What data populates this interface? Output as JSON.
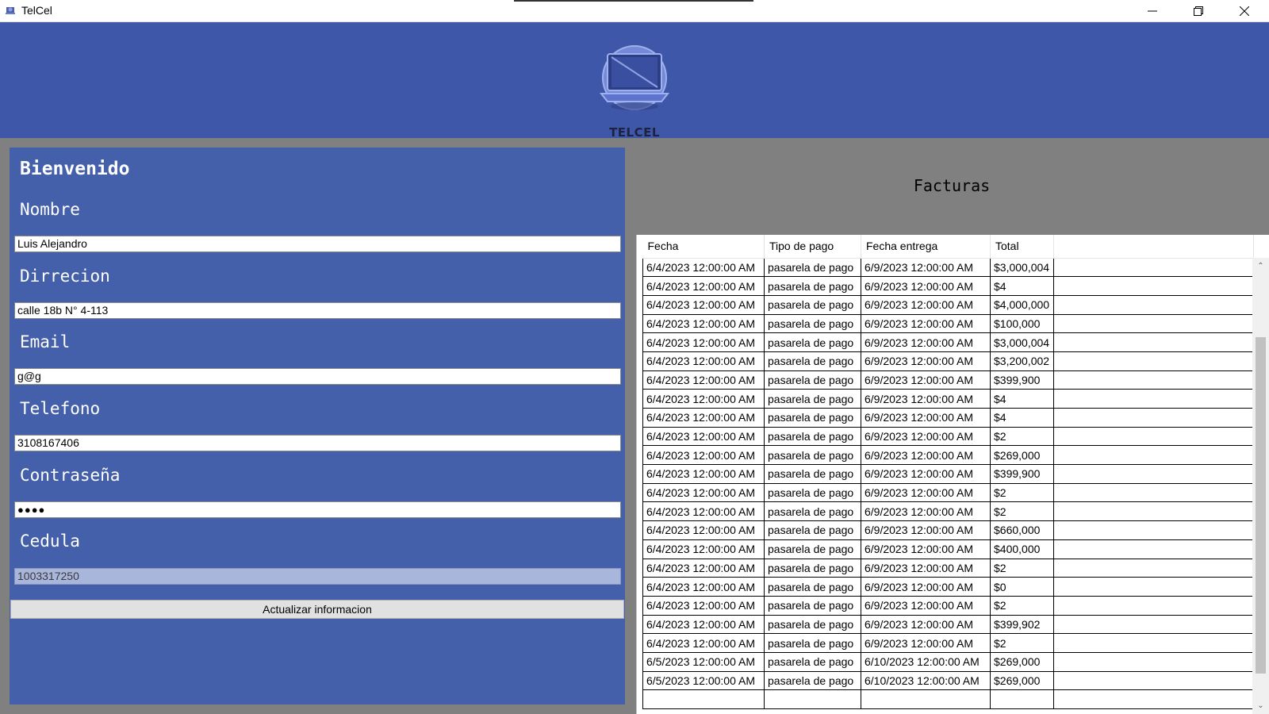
{
  "window": {
    "title": "TelCel",
    "icons": {
      "app": "app-icon",
      "minimize": "minimize-icon",
      "maximize": "restore-icon",
      "close": "close-icon"
    }
  },
  "header": {
    "logo_text": "TELCEL",
    "logo_icon": "laptop-globe-logo"
  },
  "profile": {
    "welcome": "Bienvenido",
    "fields": [
      {
        "label": "Nombre",
        "value": "Luis Alejandro"
      },
      {
        "label": "Dirrecion",
        "value": "calle 18b N° 4-113"
      },
      {
        "label": "Email",
        "value": "g@g"
      },
      {
        "label": "Telefono",
        "value": "3108167406"
      },
      {
        "label": "Contraseña",
        "value": "●●●●"
      },
      {
        "label": "Cedula",
        "value": "1003317250"
      }
    ],
    "update_button": "Actualizar informacion"
  },
  "invoices": {
    "title": "Facturas",
    "columns": [
      "Fecha",
      "Tipo de pago",
      "Fecha entrega",
      "Total"
    ],
    "rows": [
      [
        "6/4/2023 12:00:00 AM",
        "pasarela de pago",
        "6/9/2023 12:00:00 AM",
        "$3,000,004"
      ],
      [
        "6/4/2023 12:00:00 AM",
        "pasarela de pago",
        "6/9/2023 12:00:00 AM",
        "$4"
      ],
      [
        "6/4/2023 12:00:00 AM",
        "pasarela de pago",
        "6/9/2023 12:00:00 AM",
        "$4,000,000"
      ],
      [
        "6/4/2023 12:00:00 AM",
        "pasarela de pago",
        "6/9/2023 12:00:00 AM",
        "$100,000"
      ],
      [
        "6/4/2023 12:00:00 AM",
        "pasarela de pago",
        "6/9/2023 12:00:00 AM",
        "$3,000,004"
      ],
      [
        "6/4/2023 12:00:00 AM",
        "pasarela de pago",
        "6/9/2023 12:00:00 AM",
        "$3,200,002"
      ],
      [
        "6/4/2023 12:00:00 AM",
        "pasarela de pago",
        "6/9/2023 12:00:00 AM",
        "$399,900"
      ],
      [
        "6/4/2023 12:00:00 AM",
        "pasarela de pago",
        "6/9/2023 12:00:00 AM",
        "$4"
      ],
      [
        "6/4/2023 12:00:00 AM",
        "pasarela de pago",
        "6/9/2023 12:00:00 AM",
        "$4"
      ],
      [
        "6/4/2023 12:00:00 AM",
        "pasarela de pago",
        "6/9/2023 12:00:00 AM",
        "$2"
      ],
      [
        "6/4/2023 12:00:00 AM",
        "pasarela de pago",
        "6/9/2023 12:00:00 AM",
        "$269,000"
      ],
      [
        "6/4/2023 12:00:00 AM",
        "pasarela de pago",
        "6/9/2023 12:00:00 AM",
        "$399,900"
      ],
      [
        "6/4/2023 12:00:00 AM",
        "pasarela de pago",
        "6/9/2023 12:00:00 AM",
        "$2"
      ],
      [
        "6/4/2023 12:00:00 AM",
        "pasarela de pago",
        "6/9/2023 12:00:00 AM",
        "$2"
      ],
      [
        "6/4/2023 12:00:00 AM",
        "pasarela de pago",
        "6/9/2023 12:00:00 AM",
        "$660,000"
      ],
      [
        "6/4/2023 12:00:00 AM",
        "pasarela de pago",
        "6/9/2023 12:00:00 AM",
        "$400,000"
      ],
      [
        "6/4/2023 12:00:00 AM",
        "pasarela de pago",
        "6/9/2023 12:00:00 AM",
        "$2"
      ],
      [
        "6/4/2023 12:00:00 AM",
        "pasarela de pago",
        "6/9/2023 12:00:00 AM",
        "$0"
      ],
      [
        "6/4/2023 12:00:00 AM",
        "pasarela de pago",
        "6/9/2023 12:00:00 AM",
        "$2"
      ],
      [
        "6/4/2023 12:00:00 AM",
        "pasarela de pago",
        "6/9/2023 12:00:00 AM",
        "$399,902"
      ],
      [
        "6/4/2023 12:00:00 AM",
        "pasarela de pago",
        "6/9/2023 12:00:00 AM",
        "$2"
      ],
      [
        "6/5/2023 12:00:00 AM",
        "pasarela de pago",
        "6/10/2023 12:00:00 AM",
        "$269,000"
      ],
      [
        "6/5/2023 12:00:00 AM",
        "pasarela de pago",
        "6/10/2023 12:00:00 AM",
        "$269,000"
      ],
      [
        "",
        "",
        "",
        ""
      ]
    ]
  },
  "colors": {
    "header_bg": "#3f57a8",
    "panel_bg": "#4460ab",
    "window_bg": "#808080"
  }
}
